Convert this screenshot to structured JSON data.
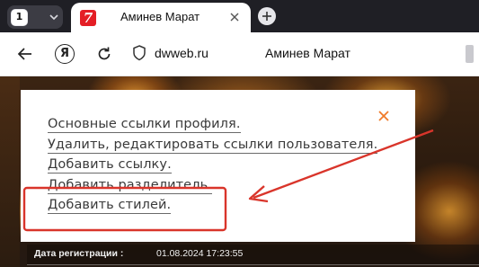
{
  "browser": {
    "tab_count": "1",
    "tab": {
      "title": "Аминев Марат",
      "favicon_glyph": "7",
      "favicon_color": "#e41e25"
    },
    "toolbar": {
      "url": "dwweb.ru",
      "page_title": "Аминев Марат",
      "ya_glyph": "Я"
    }
  },
  "modal": {
    "items": [
      "Основные ссылки профиля.",
      "Удалить, редактировать ссылки пользователя.",
      "Добавить ссылку.",
      "Добавить разделитель.",
      "Добавить стилей."
    ]
  },
  "registration": {
    "label": "Дата регистрации :",
    "value": "01.08.2024 17:23:55"
  },
  "colors": {
    "accent_orange": "#f07a2a",
    "annotation_red": "#d9352b"
  }
}
